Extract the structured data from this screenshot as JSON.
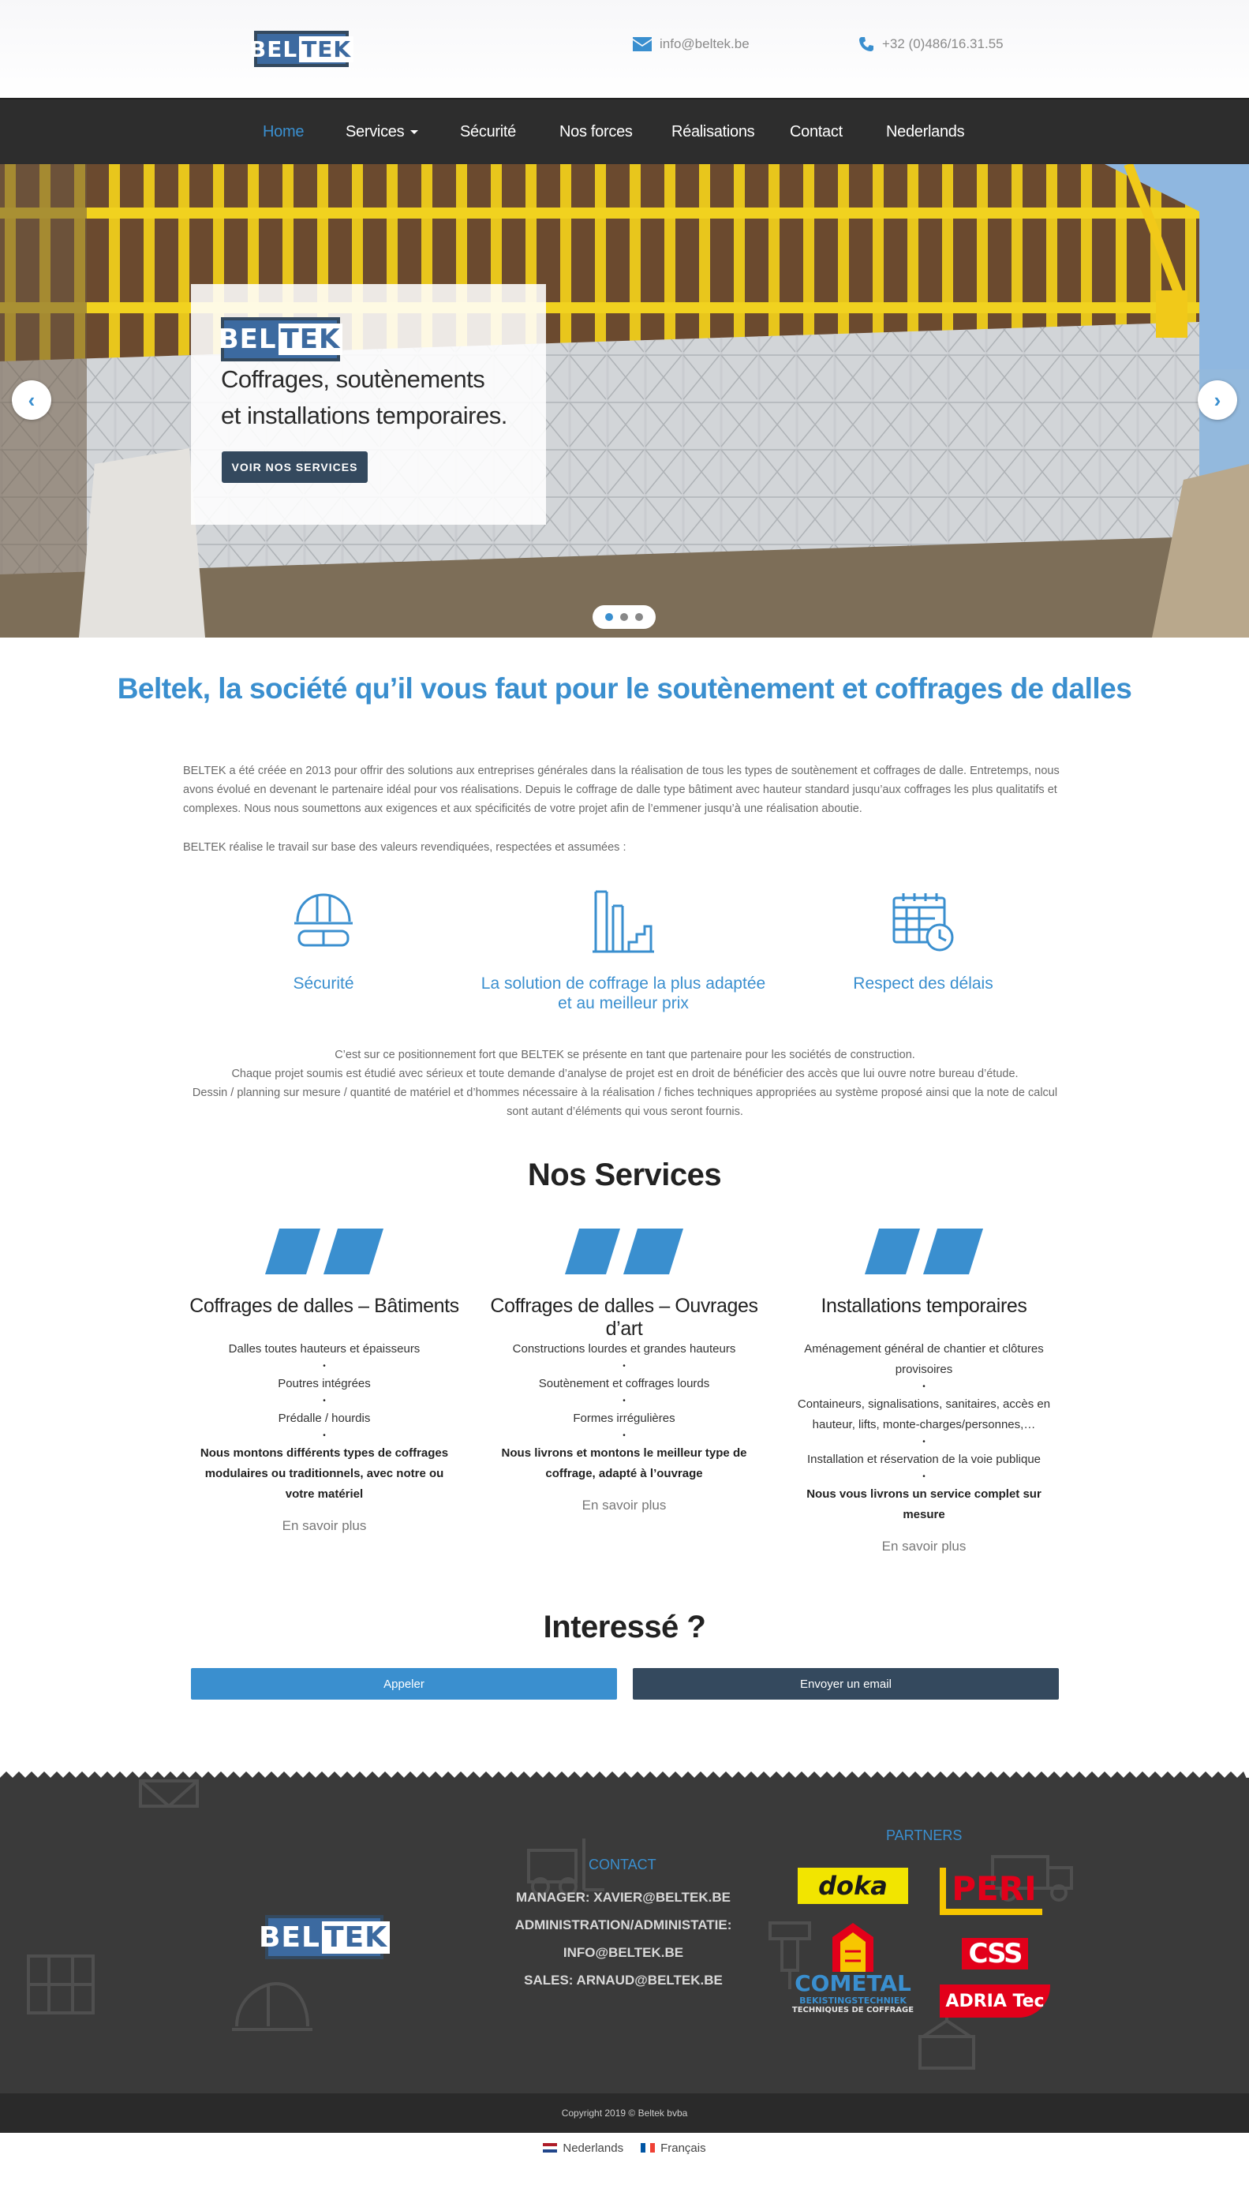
{
  "brand": {
    "logo_left": "BEL",
    "logo_right": "TEK"
  },
  "header": {
    "email": "info@beltek.be",
    "phone": "+32 (0)486/16.31.55"
  },
  "nav": {
    "home": "Home",
    "services": "Services",
    "securite": "Sécurité",
    "forces": "Nos forces",
    "realisations": "Réalisations",
    "contact": "Contact",
    "nederlands": "Nederlands"
  },
  "hero": {
    "line1": "Coffrages, soutènements",
    "line2": "et installations temporaires.",
    "button": "VOIR NOS SERVICES",
    "prev": "‹",
    "next": "›"
  },
  "intro": {
    "headline": "Beltek, la société qu’il vous faut pour le soutènement et coffrages de dalles",
    "p1": "BELTEK a été créée en 2013 pour offrir des solutions aux entreprises générales dans la réalisation de tous les types de soutènement et coffrages de dalle. Entretemps, nous avons évolué en devenant le partenaire idéal pour vos réalisations. Depuis le coffrage de dalle type bâtiment avec hauteur standard jusqu’aux coffrages les plus qualitatifs et complexes. Nous nous soumettons aux exigences et aux spécificités de votre projet afin de l’emmener jusqu’à une réalisation aboutie.",
    "p2": "BELTEK réalise le travail sur base des valeurs revendiquées, respectées et assumées :"
  },
  "features": {
    "securite": "Sécurité",
    "solution_line1": "La solution de coffrage la plus adaptée",
    "solution_line2": "et au meilleur prix",
    "delais": "Respect des délais"
  },
  "positioning": {
    "l1": "C’est sur ce positionnement fort que BELTEK se présente en tant que partenaire pour les sociétés de construction.",
    "l2": "Chaque projet soumis est étudié avec sérieux et toute demande d’analyse de projet est en droit de bénéficier des accès que lui ouvre notre bureau d’étude.",
    "l3": "Dessin / planning sur mesure / quantité de matériel et d’hommes nécessaire à la réalisation / fiches techniques appropriées au système proposé ainsi que la note de calcul sont autant d’éléments qui vous seront fournis."
  },
  "services": {
    "title": "Nos Services",
    "more": "En savoir plus",
    "col1": {
      "title": "Coffrages de dalles – Bâtiments",
      "i1": "Dalles toutes hauteurs et épaisseurs",
      "i2": "Poutres intégrées",
      "i3": "Prédalle / hourdis",
      "bold": "Nous montons différents types de coffrages modulaires ou traditionnels, avec notre ou votre matériel"
    },
    "col2": {
      "title": "Coffrages de dalles – Ouvrages d’art",
      "i1": "Constructions lourdes et grandes hauteurs",
      "i2": "Soutènement et coffrages lourds",
      "i3": "Formes irrégulières",
      "bold": "Nous livrons et montons le meilleur type de coffrage, adapté à l’ouvrage"
    },
    "col3": {
      "title": "Installations temporaires",
      "i1": "Aménagement général de chantier et clôtures provisoires",
      "i2": "Containeurs, signalisations, sanitaires, accès en hauteur, lifts, monte-charges/personnes,…",
      "i3": "Installation et réservation de la voie publique",
      "bold": "Nous vous livrons un service complet sur mesure"
    }
  },
  "cta": {
    "title": "Interessé ?",
    "call": "Appeler",
    "email": "Envoyer un email"
  },
  "footer": {
    "contact_heading": "CONTACT",
    "manager": "MANAGER: XAVIER@BELTEK.BE",
    "admin1": "ADMINISTRATION/ADMINISTATIE:",
    "admin2": "INFO@BELTEK.BE",
    "sales": "SALES: ARNAUD@BELTEK.BE",
    "partners_heading": "PARTNERS",
    "partner_doka": "doka",
    "partner_peri": "PERI",
    "partner_cometal": "COMETAL",
    "partner_cometal_sub1": "BEKISTINGSTECHNIEK",
    "partner_cometal_sub2": "TECHNIQUES DE COFFRAGE",
    "partner_css": "CSS",
    "partner_adria": "ADRIA Tec",
    "copyright": "Copyright 2019 © Beltek bvba"
  },
  "langs": {
    "nl": "Nederlands",
    "fr": "Français"
  },
  "colors": {
    "accent": "#3a8fcf",
    "dark_blue": "#34495e",
    "nav_bg": "#2d2d2d",
    "footer_bg": "#3a3a3a"
  }
}
